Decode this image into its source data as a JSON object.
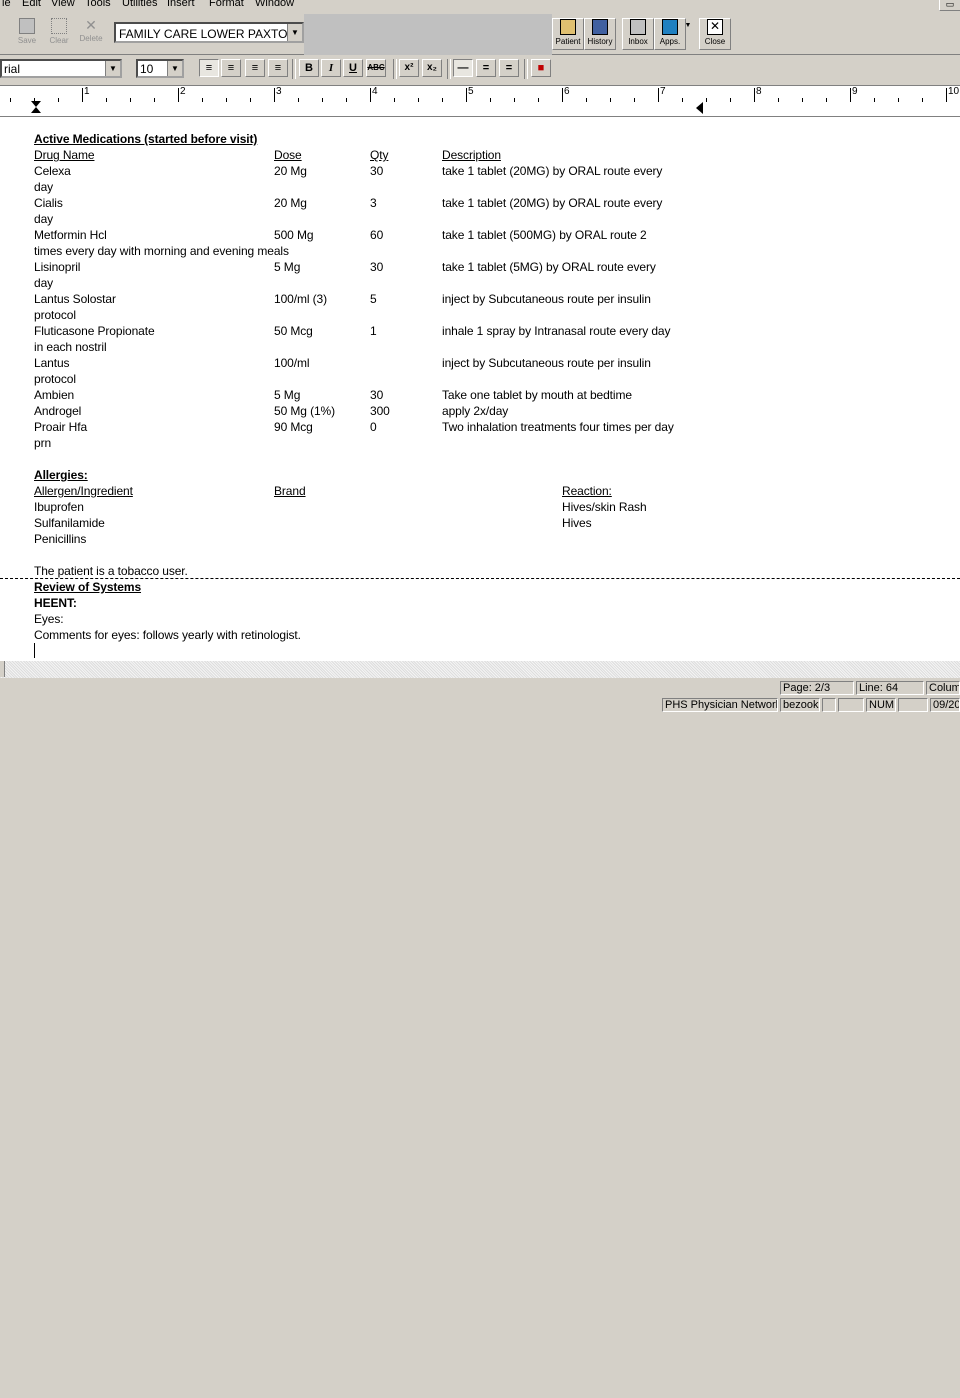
{
  "menu": [
    "le",
    "Edit",
    "View",
    "Tools",
    "Utilities",
    "Insert",
    "Format",
    "Window"
  ],
  "toolbar": {
    "save": "Save",
    "clear": "Clear",
    "delete": "Delete",
    "location": "FAMILY CARE LOWER PAXTON",
    "patient": "Patient",
    "history": "History",
    "inbox": "Inbox",
    "apps": "Apps.",
    "close": "Close"
  },
  "format": {
    "font": "Arial",
    "font_display": "rial",
    "size": "10",
    "bold": "B",
    "italic": "I",
    "underline": "U",
    "spell": "ABC",
    "superscript": "x²",
    "subscript": "x₂"
  },
  "ruler": [
    "1",
    "2",
    "3",
    "4",
    "5",
    "6",
    "7",
    "8",
    "9",
    "10"
  ],
  "doc": {
    "meds_heading": "Active Medications (started before visit)",
    "col_drug": "Drug Name",
    "col_dose": "Dose",
    "col_qty": "Qty",
    "col_desc": "Description",
    "meds": [
      {
        "name": "Celexa",
        "dose": "20 Mg",
        "qty": "30",
        "desc": "take 1 tablet (20MG)  by ORAL route  every",
        "cont": "day"
      },
      {
        "name": "Cialis",
        "dose": "20 Mg",
        "qty": "3",
        "desc": "take 1 tablet (20MG)  by ORAL route  every",
        "cont": "day"
      },
      {
        "name": "Metformin Hcl",
        "dose": "500 Mg",
        "qty": "60",
        "desc": "take 1 tablet (500MG)  by ORAL route 2",
        "cont": "times every day with morning and evening meals"
      },
      {
        "name": "Lisinopril",
        "dose": "5 Mg",
        "qty": "30",
        "desc": "take 1 tablet (5MG)  by ORAL route  every",
        "cont": "day"
      },
      {
        "name": "Lantus Solostar",
        "dose": "100/ml (3)",
        "qty": "5",
        "desc": "inject by Subcutaneous route per insulin",
        "cont": "protocol"
      },
      {
        "name": "Fluticasone Propionate",
        "dose": "50 Mcg",
        "qty": "1",
        "desc": "inhale 1 spray by Intranasal route  every day",
        "cont": "in each nostril"
      },
      {
        "name": "Lantus",
        "dose": "100/ml",
        "qty": "",
        "desc": "inject by Subcutaneous route per insulin",
        "cont": "protocol"
      },
      {
        "name": "Ambien",
        "dose": "5 Mg",
        "qty": "30",
        "desc": "Take one tablet by mouth at bedtime",
        "cont": ""
      },
      {
        "name": "Androgel",
        "dose": "50 Mg (1%)",
        "qty": "300",
        "desc": "apply 2x/day",
        "cont": ""
      },
      {
        "name": "Proair Hfa",
        "dose": "90 Mcg",
        "qty": "0",
        "desc": "Two inhalation treatments four times per day",
        "cont": "prn"
      }
    ],
    "allergies_heading": "Allergies:",
    "col_allergen": "Allergen/Ingredient",
    "col_brand": "Brand",
    "col_reaction": "Reaction:",
    "allergies": [
      {
        "allergen": "Ibuprofen",
        "reaction": "Hives/skin Rash"
      },
      {
        "allergen": "Sulfanilamide",
        "reaction": "Hives"
      },
      {
        "allergen": "Penicillins",
        "reaction": ""
      }
    ],
    "tobacco": "The patient is a tobacco user.",
    "ros_heading": "Review of Systems",
    "heent": "HEENT:",
    "eyes": "Eyes:",
    "eyes_comment": "Comments for eyes: follows yearly with retinologist."
  },
  "status": {
    "page": "Page: 2/3",
    "line": "Line: 64",
    "column": "Column",
    "network": "PHS Physician Network",
    "user": "bezook",
    "num": "NUM",
    "date": "09/20"
  }
}
